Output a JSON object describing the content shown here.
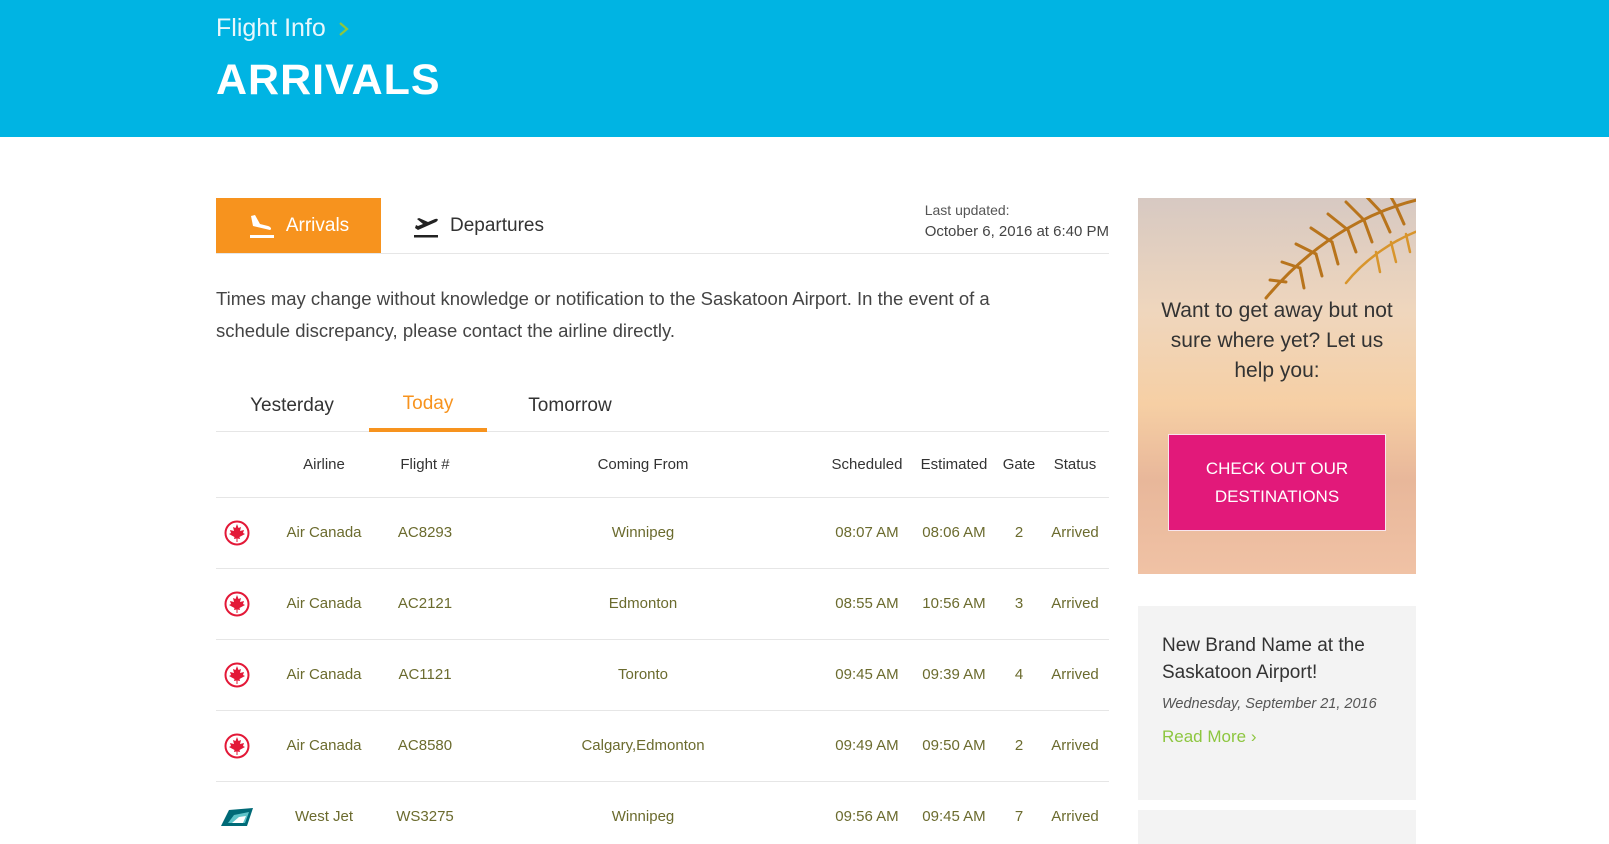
{
  "header": {
    "breadcrumb": "Flight Info",
    "title": "ARRIVALS"
  },
  "tabs": {
    "arrivals": "Arrivals",
    "departures": "Departures"
  },
  "updated": {
    "label": "Last updated:",
    "value": "October 6, 2016 at 6:40 PM"
  },
  "notice": "Times may change without knowledge or notification to the Saskatoon Airport. In the event of a schedule discrepancy, please contact the airline directly.",
  "days": [
    "Yesterday",
    "Today",
    "Tomorrow"
  ],
  "table": {
    "headers": {
      "airline": "Airline",
      "flight": "Flight #",
      "from": "Coming From",
      "scheduled": "Scheduled",
      "estimated": "Estimated",
      "gate": "Gate",
      "status": "Status"
    },
    "rows": [
      {
        "logo": "air-canada-logo",
        "airline": "Air Canada",
        "flight": "AC8293",
        "from": "Winnipeg",
        "scheduled": "08:07 AM",
        "estimated": "08:06 AM",
        "gate": "2",
        "status": "Arrived"
      },
      {
        "logo": "air-canada-logo",
        "airline": "Air Canada",
        "flight": "AC2121",
        "from": "Edmonton",
        "scheduled": "08:55 AM",
        "estimated": "10:56 AM",
        "gate": "3",
        "status": "Arrived"
      },
      {
        "logo": "air-canada-logo",
        "airline": "Air Canada",
        "flight": "AC1121",
        "from": "Toronto",
        "scheduled": "09:45 AM",
        "estimated": "09:39 AM",
        "gate": "4",
        "status": "Arrived"
      },
      {
        "logo": "air-canada-logo",
        "airline": "Air Canada",
        "flight": "AC8580",
        "from": "Calgary,Edmonton",
        "scheduled": "09:49 AM",
        "estimated": "09:50 AM",
        "gate": "2",
        "status": "Arrived"
      },
      {
        "logo": "westjet-logo",
        "airline": "West Jet",
        "flight": "WS3275",
        "from": "Winnipeg",
        "scheduled": "09:56 AM",
        "estimated": "09:45 AM",
        "gate": "7",
        "status": "Arrived"
      }
    ]
  },
  "promo": {
    "text": "Want to get away but not sure where yet? Let us help you:",
    "button": "CHECK OUT OUR DESTINATIONS"
  },
  "news": {
    "title": "New Brand Name at the Saskatoon Airport!",
    "date": "Wednesday, September 21, 2016",
    "more": "Read More ›"
  },
  "colors": {
    "header": "#00b4e3",
    "accent": "#f7931e",
    "promo_button": "#e2197a",
    "link": "#8dc63f"
  }
}
